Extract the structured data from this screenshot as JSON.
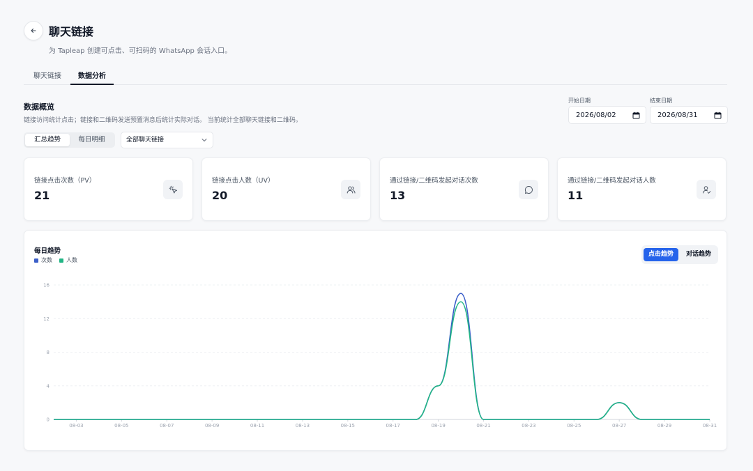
{
  "header": {
    "title": "聊天链接",
    "subtitle": "为 Tapleap 创建可点击、可扫码的 WhatsApp 会话入口。"
  },
  "tabs": [
    {
      "label": "聊天链接",
      "active": false
    },
    {
      "label": "数据分析",
      "active": true
    }
  ],
  "overview": {
    "title": "数据概览",
    "description": "链接访问统计点击；链接和二维码发送预置消息后统计实际对话。 当前统计全部聊天链接和二维码。"
  },
  "date_range": {
    "start_label": "开始日期",
    "start_value": "2026/08/02",
    "end_label": "结束日期",
    "end_value": "2026/08/31"
  },
  "view_toggle": {
    "summary": "汇总趋势",
    "daily": "每日明细",
    "selected": "汇总趋势"
  },
  "link_filter": {
    "value": "全部聊天链接"
  },
  "stats": [
    {
      "label": "链接点击次数（PV）",
      "value": "21",
      "icon": "cursor-click-icon"
    },
    {
      "label": "链接点击人数（UV）",
      "value": "20",
      "icon": "users-icon"
    },
    {
      "label": "通过链接/二维码发起对话次数",
      "value": "13",
      "icon": "chat-bubble-icon"
    },
    {
      "label": "通过链接/二维码发起对话人数",
      "value": "11",
      "icon": "user-check-icon"
    }
  ],
  "chart_card": {
    "title": "每日趋势",
    "toggle_click": "点击趋势",
    "toggle_chat": "对话趋势",
    "selected": "点击趋势"
  },
  "colors": {
    "accent": "#2563eb",
    "series_count": "#3b5fc9",
    "series_people": "#22b585"
  },
  "chart_data": {
    "type": "line",
    "smooth": true,
    "grid": true,
    "legend_position": "top-left",
    "x": [
      "08-02",
      "08-03",
      "08-04",
      "08-05",
      "08-06",
      "08-07",
      "08-08",
      "08-09",
      "08-10",
      "08-11",
      "08-12",
      "08-13",
      "08-14",
      "08-15",
      "08-16",
      "08-17",
      "08-18",
      "08-19",
      "08-20",
      "08-21",
      "08-22",
      "08-23",
      "08-24",
      "08-25",
      "08-26",
      "08-27",
      "08-28",
      "08-29",
      "08-30",
      "08-31"
    ],
    "x_tick_labels": [
      "08-03",
      "08-05",
      "08-07",
      "08-09",
      "08-11",
      "08-13",
      "08-15",
      "08-17",
      "08-19",
      "08-21",
      "08-23",
      "08-25",
      "08-27",
      "08-29",
      "08-31"
    ],
    "ylim": [
      0,
      16
    ],
    "y_ticks": [
      0,
      4,
      8,
      12,
      16
    ],
    "series": [
      {
        "name": "次数",
        "values": [
          0,
          0,
          0,
          0,
          0,
          0,
          0,
          0,
          0,
          0,
          0,
          0,
          0,
          0,
          0,
          0,
          0,
          4,
          15,
          0,
          0,
          0,
          0,
          0,
          0,
          2,
          0,
          0,
          0,
          0
        ]
      },
      {
        "name": "人数",
        "values": [
          0,
          0,
          0,
          0,
          0,
          0,
          0,
          0,
          0,
          0,
          0,
          0,
          0,
          0,
          0,
          0,
          0,
          4,
          14,
          0,
          0,
          0,
          0,
          0,
          0,
          2,
          0,
          0,
          0,
          0
        ]
      }
    ]
  }
}
